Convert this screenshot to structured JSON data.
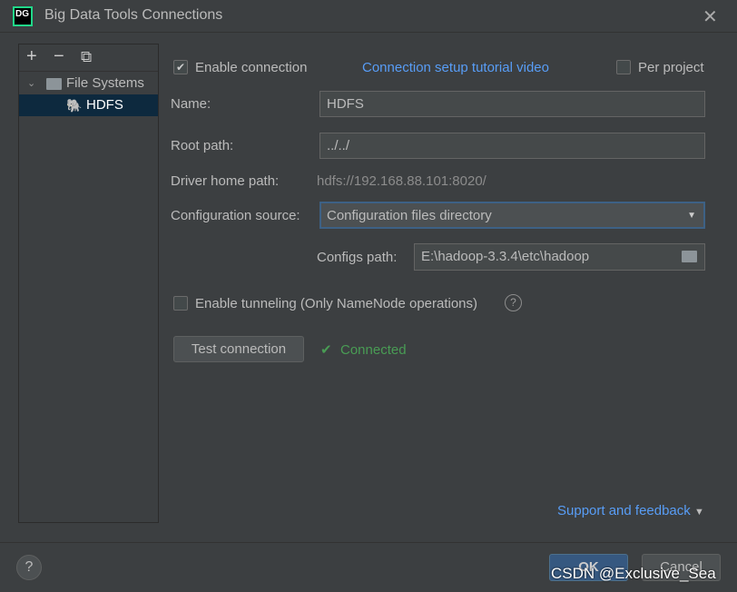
{
  "window": {
    "title": "Big Data Tools Connections",
    "logo": "DG"
  },
  "tree": {
    "toolbar": {
      "add": "+",
      "remove": "−",
      "copy": "⧉"
    },
    "group": "File Systems",
    "item": "HDFS"
  },
  "form": {
    "enable_connection": {
      "label": "Enable connection",
      "checked": true
    },
    "tutorial_link": "Connection setup tutorial video",
    "per_project": {
      "label": "Per project",
      "checked": false
    },
    "name": {
      "label": "Name:",
      "value": "HDFS"
    },
    "root_path": {
      "label": "Root path:",
      "value": "../../"
    },
    "driver_home": {
      "label": "Driver home path:",
      "value": "hdfs://192.168.88.101:8020/"
    },
    "config_source": {
      "label": "Configuration source:",
      "value": "Configuration files directory"
    },
    "configs_path": {
      "label": "Configs path:",
      "value": "E:\\hadoop-3.3.4\\etc\\hadoop"
    },
    "tunneling": {
      "label": "Enable tunneling (Only NameNode operations)",
      "checked": false
    },
    "test_button": "Test connection",
    "status": "Connected"
  },
  "support_link": "Support and feedback",
  "buttons": {
    "ok": "OK",
    "cancel": "Cancel",
    "help": "?"
  },
  "watermark": "CSDN @Exclusive_Sea",
  "colors": {
    "accent": "#589df6",
    "success": "#499c54",
    "selection": "#0d293e"
  }
}
